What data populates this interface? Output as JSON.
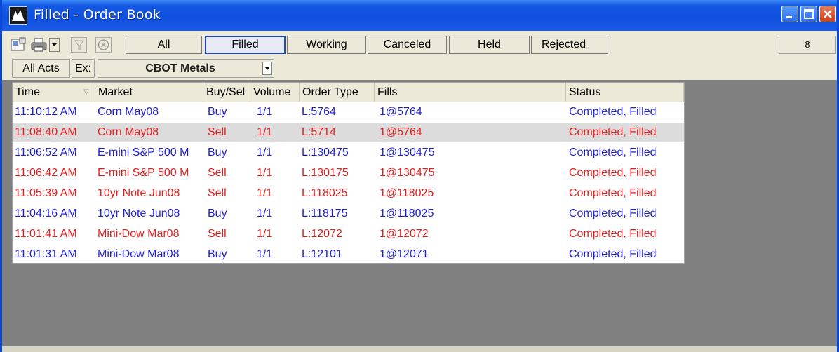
{
  "window": {
    "title": "Filled - Order Book"
  },
  "toolbar": {
    "icons": [
      "properties-icon",
      "print-icon",
      "dropdown-arrow-icon",
      "filter-icon",
      "cancel-circle-icon"
    ],
    "filters": [
      "All",
      "Filled",
      "Working",
      "Canceled",
      "Held",
      "Rejected"
    ],
    "active_filter": "Filled",
    "count": "8"
  },
  "account_bar": {
    "accounts_label": "All Acts",
    "exchange_label": "Ex:",
    "exchange_value": "CBOT Metals"
  },
  "grid": {
    "columns": [
      "Time",
      "Market",
      "Buy/Sel",
      "Volume",
      "Order Type",
      "Fills",
      "Status"
    ],
    "rows": [
      {
        "time": "11:10:12 AM",
        "market": "Corn May08",
        "side": "Buy",
        "volume": "1/1",
        "order_type": "L:5764",
        "fills": "1@5764",
        "status": "Completed, Filled"
      },
      {
        "time": "11:08:40 AM",
        "market": "Corn May08",
        "side": "Sell",
        "volume": "1/1",
        "order_type": "L:5714",
        "fills": "1@5764",
        "status": "Completed, Filled"
      },
      {
        "time": "11:06:52 AM",
        "market": "E-mini S&P 500 M",
        "side": "Buy",
        "volume": "1/1",
        "order_type": "L:130475",
        "fills": "1@130475",
        "status": "Completed, Filled"
      },
      {
        "time": "11:06:42 AM",
        "market": "E-mini S&P 500 M",
        "side": "Sell",
        "volume": "1/1",
        "order_type": "L:130175",
        "fills": "1@130475",
        "status": "Completed, Filled"
      },
      {
        "time": "11:05:39 AM",
        "market": "10yr Note Jun08",
        "side": "Sell",
        "volume": "1/1",
        "order_type": "L:118025",
        "fills": "1@118025",
        "status": "Completed, Filled"
      },
      {
        "time": "11:04:16 AM",
        "market": "10yr Note Jun08",
        "side": "Buy",
        "volume": "1/1",
        "order_type": "L:118175",
        "fills": "1@118025",
        "status": "Completed, Filled"
      },
      {
        "time": "11:01:41 AM",
        "market": "Mini-Dow Mar08",
        "side": "Sell",
        "volume": "1/1",
        "order_type": "L:12072",
        "fills": "1@12072",
        "status": "Completed, Filled"
      },
      {
        "time": "11:01:31 AM",
        "market": "Mini-Dow Mar08",
        "side": "Buy",
        "volume": "1/1",
        "order_type": "L:12101",
        "fills": "1@12071",
        "status": "Completed, Filled"
      }
    ],
    "selected_row": 1
  },
  "colors": {
    "buy": "#1f1fd8",
    "sell": "#e51d1d",
    "titlebar": "#0f50de",
    "background": "#808080",
    "toolbar_bg": "#ece9d8"
  }
}
